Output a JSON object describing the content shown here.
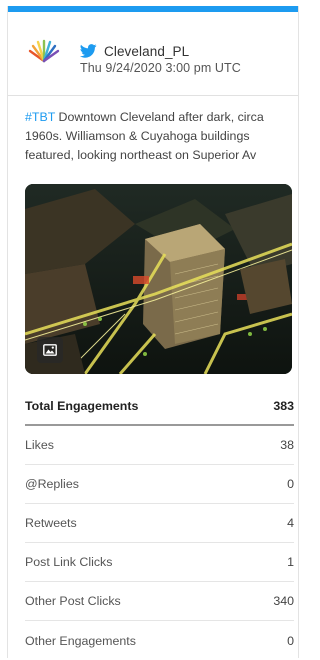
{
  "account": {
    "handle": "Cleveland_PL",
    "date": "Thu 9/24/2020 3:00 pm UTC",
    "logo_icon": "library-sunburst-logo",
    "platform_icon": "twitter-bird-icon"
  },
  "tweet": {
    "hashtag": "#TBT",
    "line1": " Downtown Cleveland after dark, circa",
    "line2": "1960s. Williamson & Cuyahoga buildings",
    "line3": "featured, looking northeast on Superior Av"
  },
  "photo": {
    "badge_icon": "image-icon"
  },
  "metrics": {
    "rows": [
      {
        "label": "Total Engagements",
        "value": "383"
      },
      {
        "label": "Likes",
        "value": "38"
      },
      {
        "label": "@Replies",
        "value": "0"
      },
      {
        "label": "Retweets",
        "value": "4"
      },
      {
        "label": "Post Link Clicks",
        "value": "1"
      },
      {
        "label": "Other Post Clicks",
        "value": "340"
      },
      {
        "label": "Other Engagements",
        "value": "0"
      }
    ]
  },
  "colors": {
    "accent": "#1d9bf0",
    "hashtag": "#1d9bf0"
  }
}
